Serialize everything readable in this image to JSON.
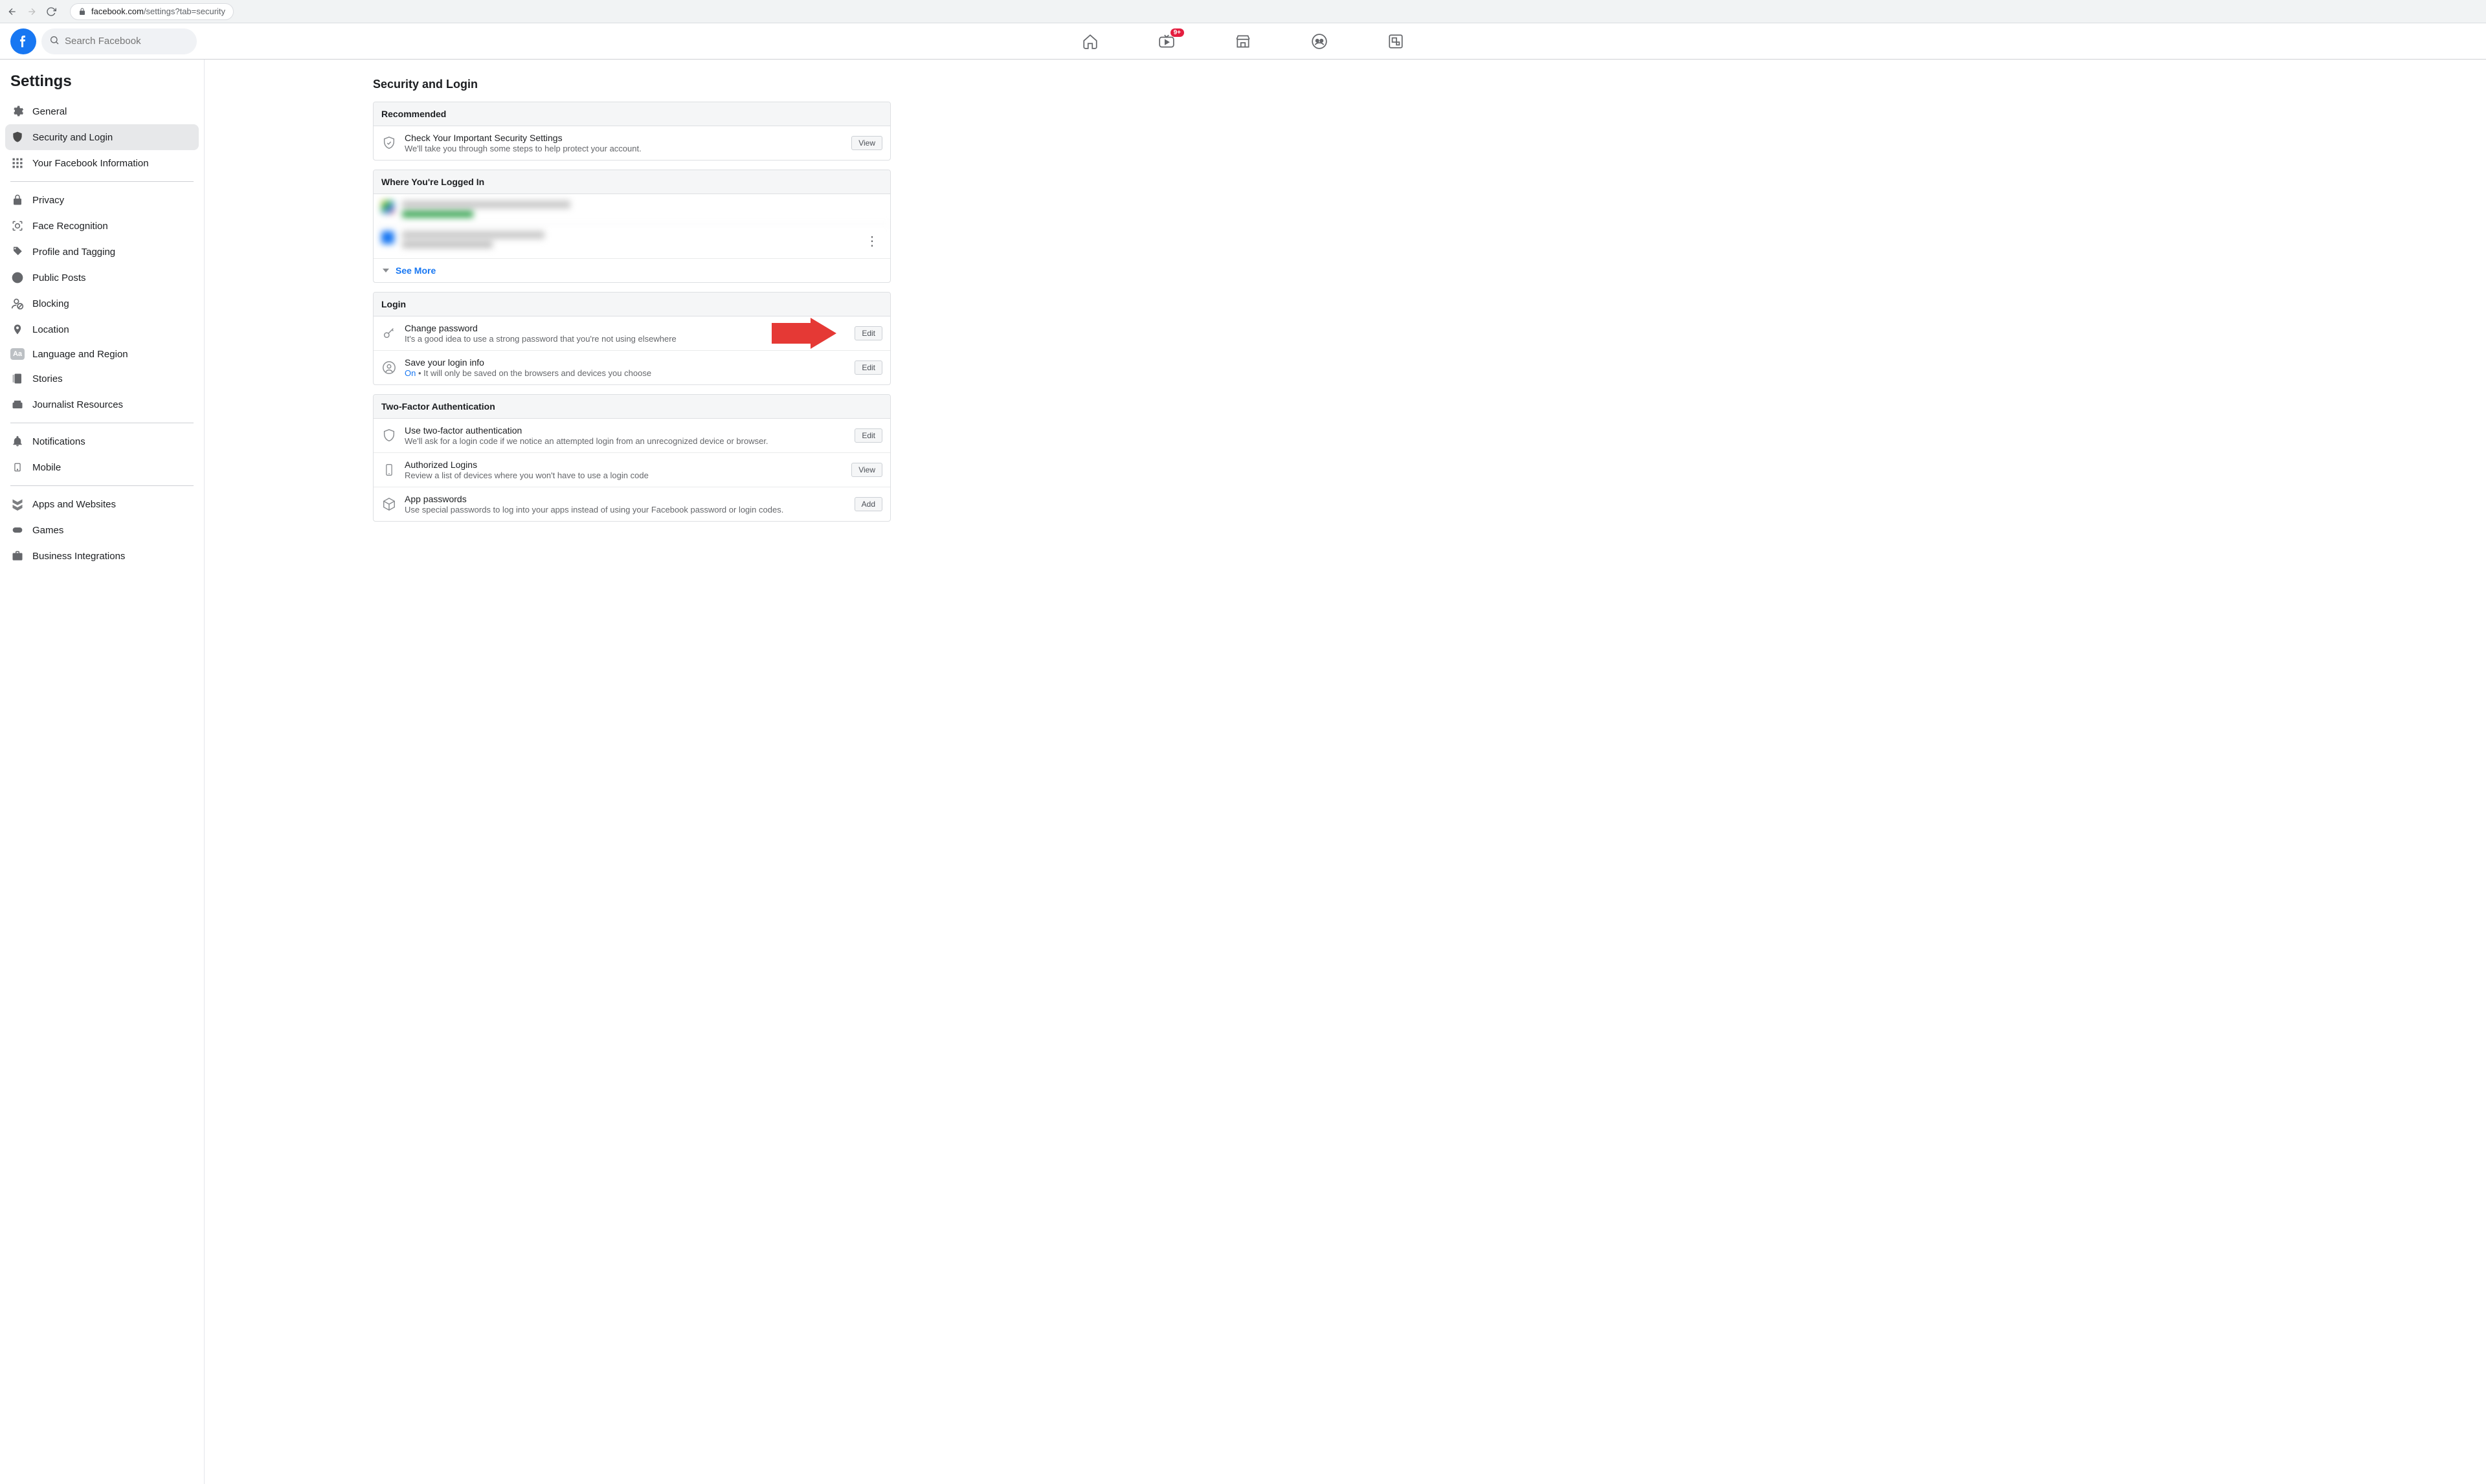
{
  "browser": {
    "url_host": "facebook.com",
    "url_path": "/settings?tab=security"
  },
  "topbar": {
    "search_placeholder": "Search Facebook",
    "badge_watch": "9+"
  },
  "sidebar": {
    "title": "Settings",
    "items": [
      {
        "label": "General",
        "icon": "gear"
      },
      {
        "label": "Security and Login",
        "icon": "shield",
        "active": true
      },
      {
        "label": "Your Facebook Information",
        "icon": "grid"
      }
    ],
    "items2": [
      {
        "label": "Privacy",
        "icon": "lock"
      },
      {
        "label": "Face Recognition",
        "icon": "face"
      },
      {
        "label": "Profile and Tagging",
        "icon": "tag"
      },
      {
        "label": "Public Posts",
        "icon": "globe"
      },
      {
        "label": "Blocking",
        "icon": "block"
      },
      {
        "label": "Location",
        "icon": "pin"
      },
      {
        "label": "Language and Region",
        "icon": "aa"
      },
      {
        "label": "Stories",
        "icon": "stories"
      },
      {
        "label": "Journalist Resources",
        "icon": "press"
      }
    ],
    "items3": [
      {
        "label": "Notifications",
        "icon": "bell"
      },
      {
        "label": "Mobile",
        "icon": "mobile"
      }
    ],
    "items4": [
      {
        "label": "Apps and Websites",
        "icon": "apps"
      },
      {
        "label": "Games",
        "icon": "games"
      },
      {
        "label": "Business Integrations",
        "icon": "briefcase"
      }
    ]
  },
  "main": {
    "title": "Security and Login",
    "recommended": {
      "header": "Recommended",
      "row_title": "Check Your Important Security Settings",
      "row_sub": "We'll take you through some steps to help protect your account.",
      "btn": "View"
    },
    "logged_in": {
      "header": "Where You're Logged In",
      "see_more": "See More"
    },
    "login": {
      "header": "Login",
      "change_pw_title": "Change password",
      "change_pw_sub": "It's a good idea to use a strong password that you're not using elsewhere",
      "change_pw_btn": "Edit",
      "save_login_title": "Save your login info",
      "save_login_on": "On",
      "save_login_sep": " • ",
      "save_login_sub": "It will only be saved on the browsers and devices you choose",
      "save_login_btn": "Edit"
    },
    "twofa": {
      "header": "Two-Factor Authentication",
      "use2fa_title": "Use two-factor authentication",
      "use2fa_sub": "We'll ask for a login code if we notice an attempted login from an unrecognized device or browser.",
      "use2fa_btn": "Edit",
      "auth_title": "Authorized Logins",
      "auth_sub": "Review a list of devices where you won't have to use a login code",
      "auth_btn": "View",
      "apppw_title": "App passwords",
      "apppw_sub": "Use special passwords to log into your apps instead of using your Facebook password or login codes.",
      "apppw_btn": "Add"
    }
  }
}
